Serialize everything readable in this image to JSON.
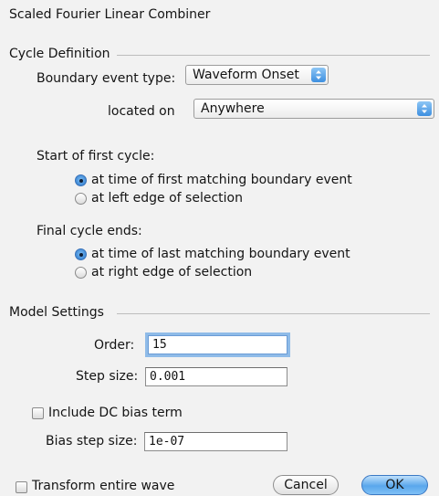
{
  "window": {
    "title": "Scaled Fourier Linear Combiner"
  },
  "cycle_definition": {
    "section_label": "Cycle Definition",
    "boundary_event_type": {
      "label": "Boundary event type:",
      "value": "Waveform Onset"
    },
    "located_on": {
      "label": "located on",
      "value": "Anywhere"
    },
    "start_of_first_cycle": {
      "label": "Start of first cycle:",
      "options": [
        {
          "label": "at time of first matching boundary event",
          "selected": true
        },
        {
          "label": "at left edge of selection",
          "selected": false
        }
      ]
    },
    "final_cycle_ends": {
      "label": "Final cycle ends:",
      "options": [
        {
          "label": "at time of last matching boundary event",
          "selected": true
        },
        {
          "label": "at right edge of selection",
          "selected": false
        }
      ]
    }
  },
  "model_settings": {
    "section_label": "Model Settings",
    "order": {
      "label": "Order:",
      "value": "15"
    },
    "step_size": {
      "label": "Step size:",
      "value": "0.001"
    },
    "include_dc_bias": {
      "label": "Include DC bias term",
      "checked": false
    },
    "bias_step_size": {
      "label": "Bias step size:",
      "value": "1e-07"
    }
  },
  "footer": {
    "transform_entire_wave": {
      "label": "Transform entire wave",
      "checked": false
    },
    "cancel_label": "Cancel",
    "ok_label": "OK"
  },
  "colors": {
    "accent": "#3f8ad6",
    "focus_ring": "#8fbbe8"
  }
}
